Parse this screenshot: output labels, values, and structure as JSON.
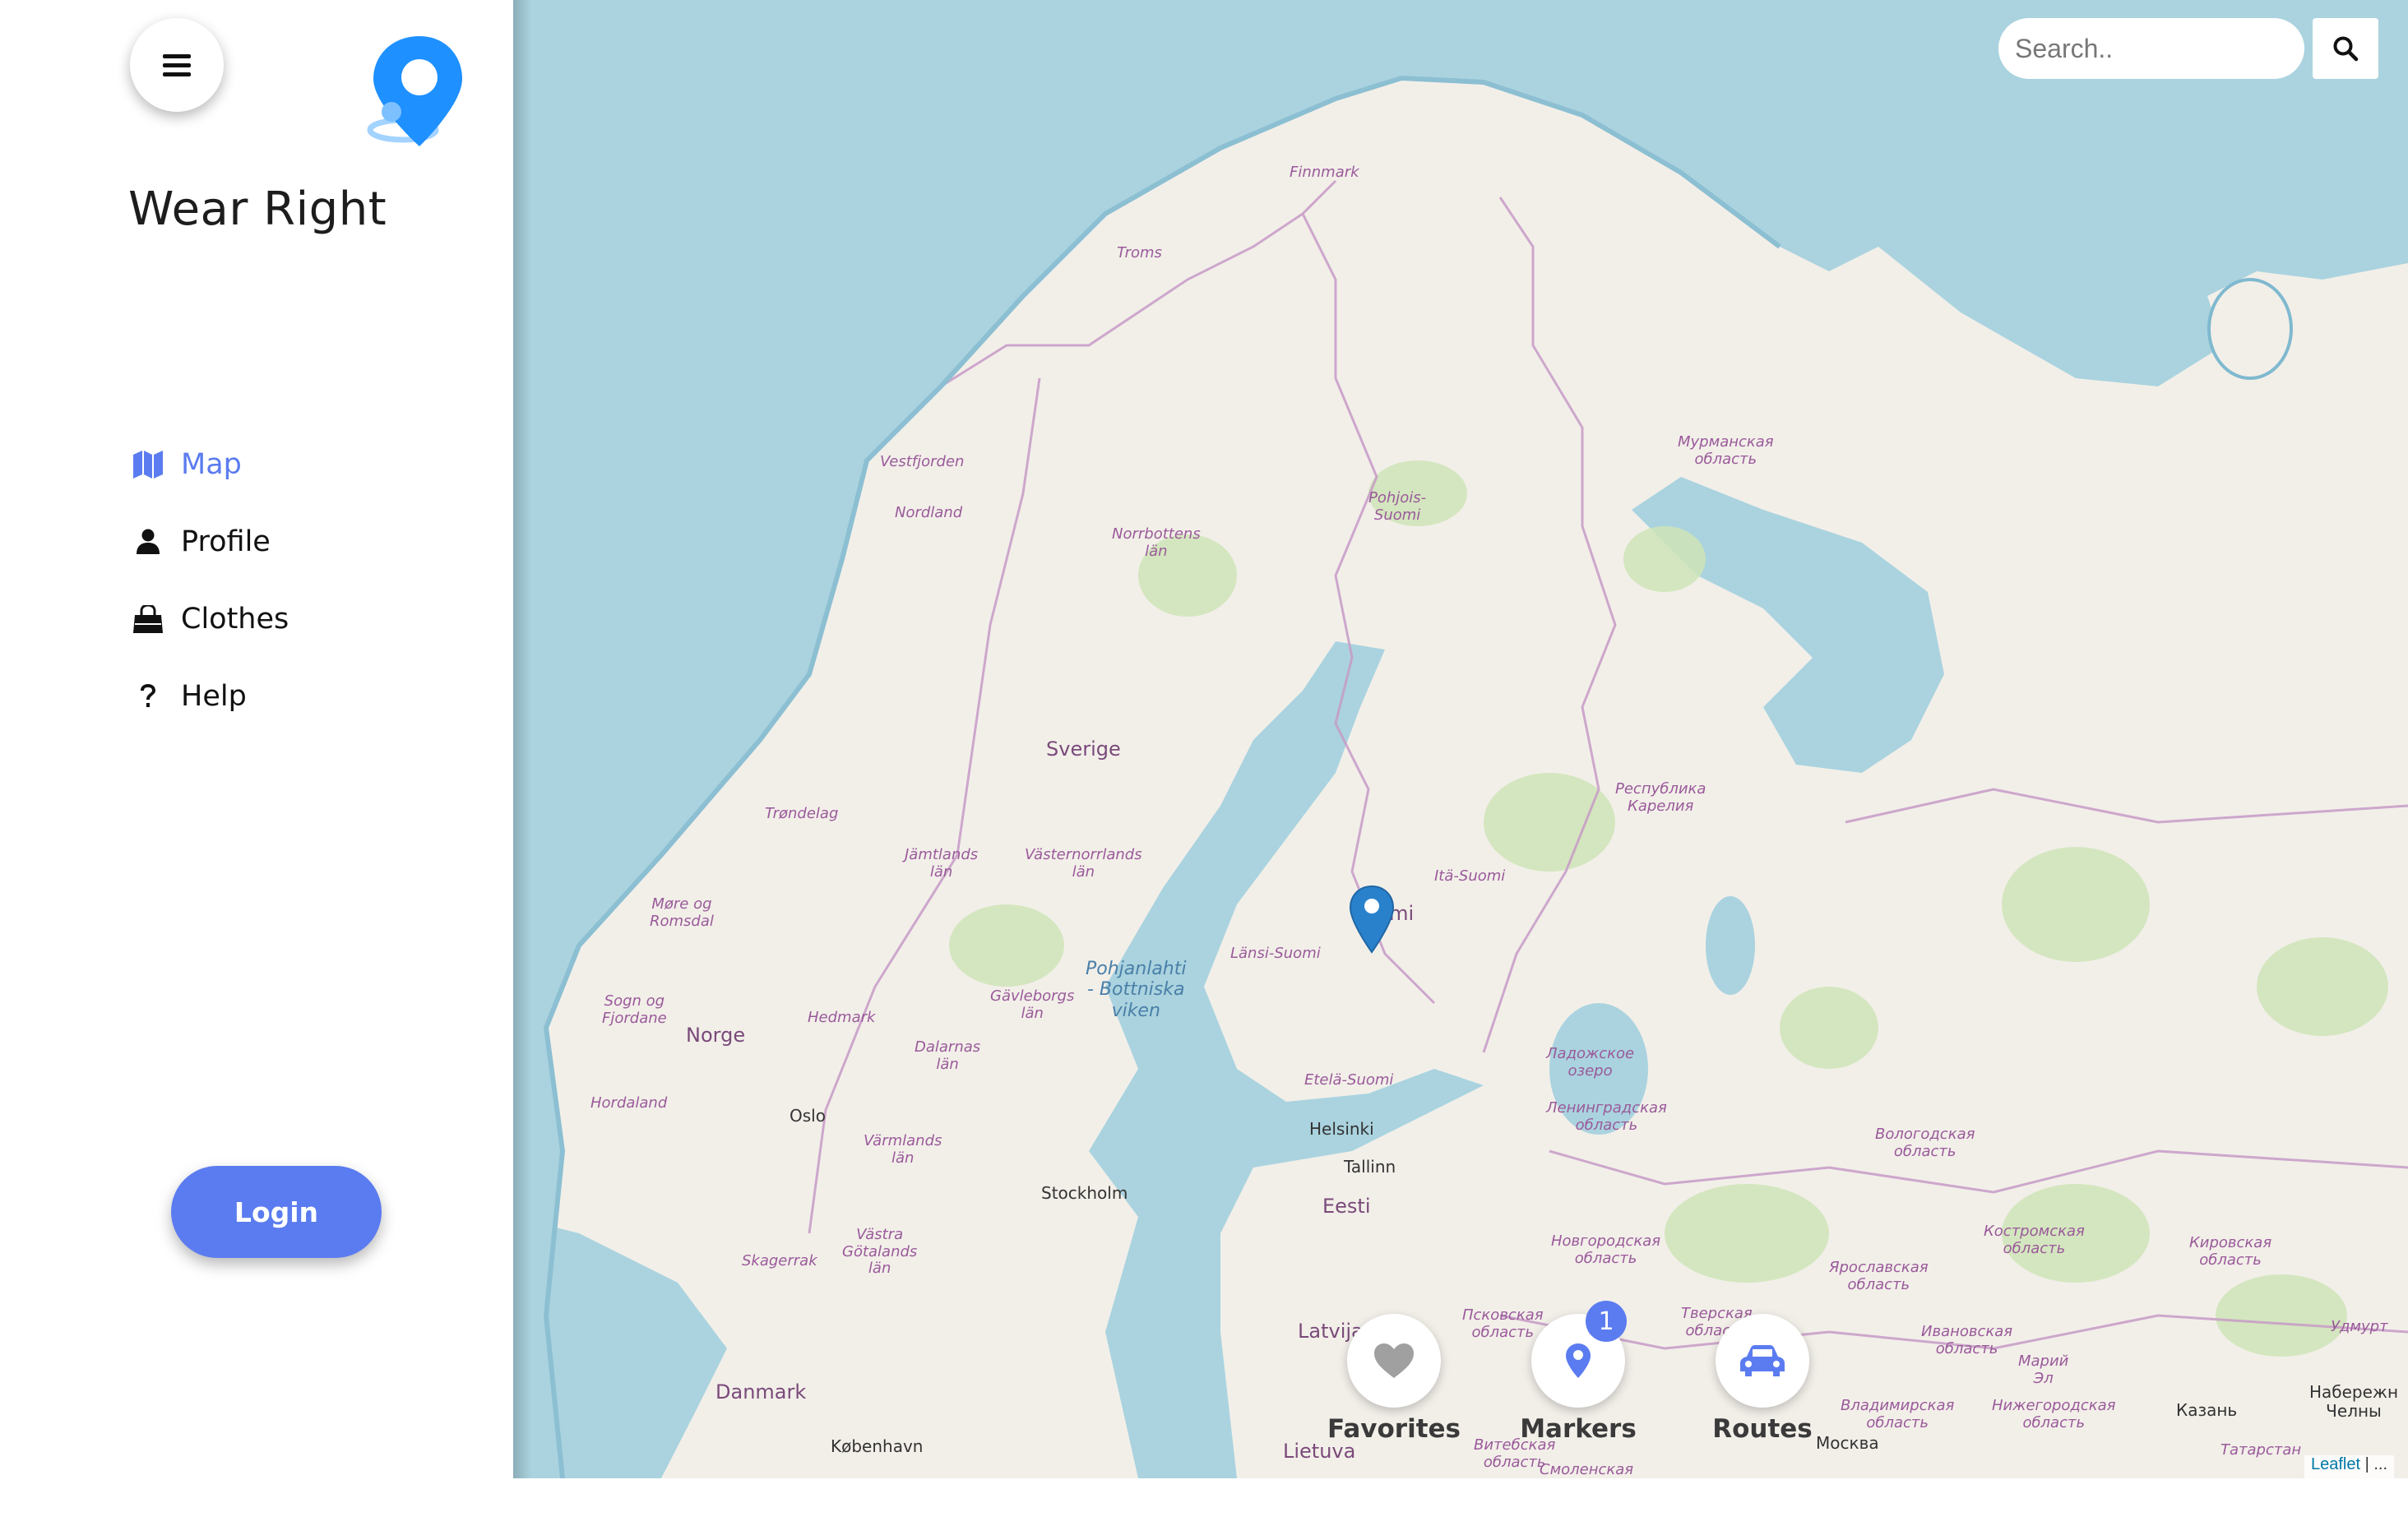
{
  "app": {
    "title": "Wear Right"
  },
  "nav": {
    "items": [
      {
        "label": "Map",
        "icon": "map-icon",
        "active": true
      },
      {
        "label": "Profile",
        "icon": "user-icon",
        "active": false
      },
      {
        "label": "Clothes",
        "icon": "shopping-bag-icon",
        "active": false
      },
      {
        "label": "Help",
        "icon": "question-icon",
        "active": false
      }
    ]
  },
  "login": {
    "label": "Login"
  },
  "search": {
    "placeholder": "Search.."
  },
  "map_labels": {
    "finnmark": "Finnmark",
    "troms": "Troms",
    "vestfjorden": "Vestfjorden",
    "nordland": "Nordland",
    "norrbottens": "Norrbottens\nlän",
    "pohjois_suomi": "Pohjois-\nSuomi",
    "murmansk": "Мурманская\nобласть",
    "sverige": "Sverige",
    "karelia": "Республика\nКарелия",
    "trondelag": "Trøndelag",
    "jamtlands": "Jämtlands\nlän",
    "vasternorrlands": "Västernorrlands\nlän",
    "ita_suomi": "Itä-Suomi",
    "suomi": "Suomi",
    "more_romsdal": "Møre og\nRomsdal",
    "lansi_suomi": "Länsi-Suomi",
    "pohjanlahti": "Pohjanlahti\n- Bottniska\nviken",
    "gavleborgs": "Gävleborgs\nlän",
    "sogn": "Sogn og\nFjordane",
    "norge": "Norge",
    "hedmark": "Hedmark",
    "dalarnas": "Dalarnas\nlän",
    "ladoga": "Ладожское\nозеро",
    "hordaland": "Hordaland",
    "etela_suomi": "Etelä-Suomi",
    "helsinki": "Helsinki",
    "leningrad": "Ленинградская\nобласть",
    "oslo": "Oslo",
    "varmlands": "Värmlands\nlän",
    "tallinn": "Tallinn",
    "vologda": "Вологодская\nобласть",
    "stockholm": "Stockholm",
    "eesti": "Eesti",
    "novgorod": "Новгородская\nобласть",
    "kostroma": "Костромская\nобласть",
    "kirov": "Кировская\nобласть",
    "vastra_gotaland": "Västra\nGötalands\nlän",
    "skagerrak": "Skagerrak",
    "yaroslavl": "Ярославская\nобласть",
    "pskov": "Псковская\nобласть",
    "tver": "Тверская\nобласть",
    "ivanovo": "Ивановская\nобласть",
    "udmurt": "Удмурт",
    "latvija": "Latvija",
    "mariy": "Марий\nЭл",
    "kazan": "Казань",
    "naberezhnye": "Набережн\nЧелны",
    "danmark": "Danmark",
    "vladimir": "Владимирская\nобласть",
    "nizhny": "Нижегородская\nобласть",
    "kobenhavn": "København",
    "lietuva": "Lietuva",
    "vitebsk": "Витебская\nобласть",
    "moskva": "Москва",
    "smolensk": "Смоленская",
    "tatarstan": "Татарстан"
  },
  "bottom_actions": {
    "favorites": {
      "label": "Favorites",
      "icon": "heart-icon"
    },
    "markers": {
      "label": "Markers",
      "icon": "map-pin-icon",
      "badge": "1"
    },
    "routes": {
      "label": "Routes",
      "icon": "car-icon"
    }
  },
  "attribution": {
    "leaflet": "Leaflet",
    "separator": " | ..."
  },
  "colors": {
    "accent": "#5b7cf0",
    "water": "#aad3df",
    "land": "#f2efe9",
    "forest": "#cfe4b7",
    "border": "#c79ac7",
    "logo": "#1e90ff"
  }
}
